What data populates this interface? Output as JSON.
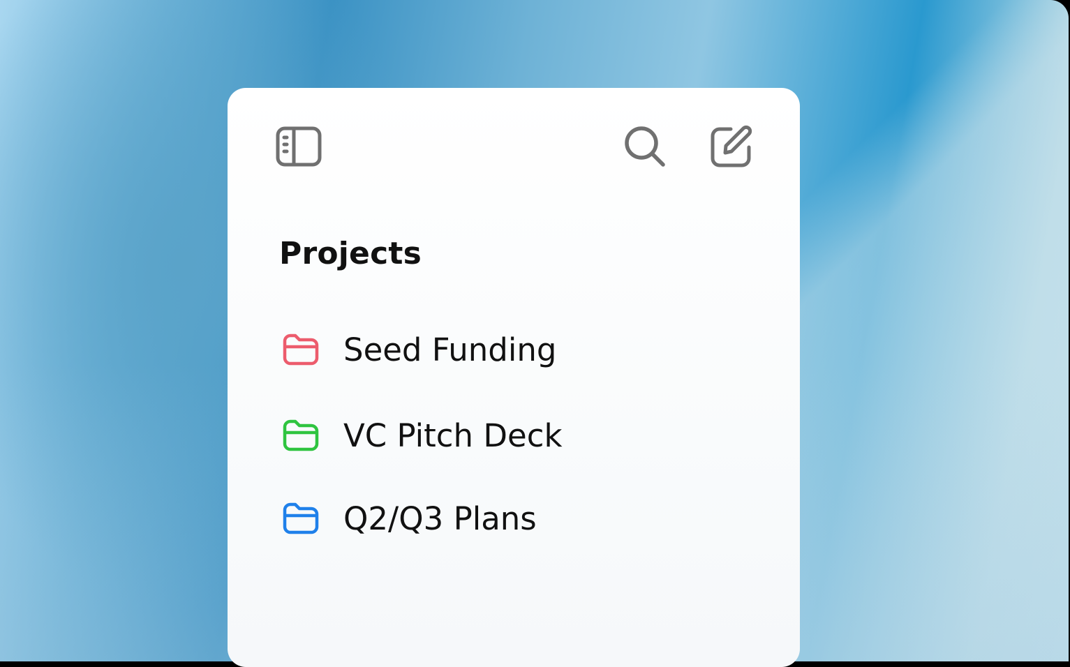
{
  "toolbar": {
    "sidebar_toggle_icon": "sidebar-icon",
    "search_icon": "search-icon",
    "compose_icon": "compose-icon",
    "icon_color": "#707070"
  },
  "section": {
    "title": "Projects"
  },
  "projects": [
    {
      "label": "Seed Funding",
      "icon": "folder-icon",
      "color": "#ec5c6d"
    },
    {
      "label": "VC Pitch Deck",
      "icon": "folder-icon",
      "color": "#2fc440"
    },
    {
      "label": "Q2/Q3 Plans",
      "icon": "folder-icon",
      "color": "#1f80ea"
    }
  ]
}
